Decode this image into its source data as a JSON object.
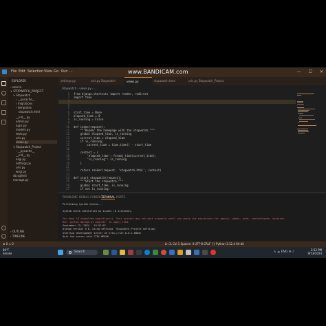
{
  "titlebar": {
    "menu": [
      "File",
      "Edit",
      "Selection",
      "View",
      "Go",
      "Run",
      "···"
    ],
    "watermark": "www.BANDICAM.com"
  },
  "sidebar": {
    "title": "EXPLORER",
    "items": [
      {
        "label": "› source"
      },
      {
        "label": "∨ STOPWATCH_PROJECT"
      },
      {
        "label": "∨ Stopwatch"
      },
      {
        "label": "› __pycache__"
      },
      {
        "label": "› migrations"
      },
      {
        "label": "› templates"
      },
      {
        "label": "stopwatch.html"
      },
      {
        "label": "__init__.py"
      },
      {
        "label": "admin.py"
      },
      {
        "label": "apps.py"
      },
      {
        "label": "models.py"
      },
      {
        "label": "tests.py"
      },
      {
        "label": "urls.py"
      },
      {
        "label": "views.py"
      },
      {
        "label": "∨ Stopwatch_Project"
      },
      {
        "label": "› __pycache__"
      },
      {
        "label": "__init__.py"
      },
      {
        "label": "asgi.py"
      },
      {
        "label": "settings.py"
      },
      {
        "label": "urls.py"
      },
      {
        "label": "wsgi.py"
      },
      {
        "label": "db.sqlite3"
      },
      {
        "label": "manage.py"
      },
      {
        "label": "› OUTLINE"
      },
      {
        "label": "› TIMELINE"
      }
    ]
  },
  "tabs": [
    {
      "label": "settings.py"
    },
    {
      "label": "urls.py  Stopwatch"
    },
    {
      "label": "views.py"
    },
    {
      "label": "stopwatch.html"
    },
    {
      "label": "urls.py  Stopwatch_Project"
    }
  ],
  "breadcrumb": "Stopwatch  ›  views.py  ›  ...",
  "editor": {
    "lines": [
      {
        "n": "1",
        "t": "from django.shortcuts import render, redirect"
      },
      {
        "n": "2",
        "t": "import time"
      },
      {
        "n": "3",
        "t": ""
      },
      {
        "n": "4",
        "t": ""
      },
      {
        "n": "5",
        "t": ""
      },
      {
        "n": "6",
        "t": "start_time = None"
      },
      {
        "n": "7",
        "t": "elapsed_time = 0"
      },
      {
        "n": "8",
        "t": "is_running = False"
      },
      {
        "n": "9",
        "t": ""
      },
      {
        "n": "10",
        "t": "def index(request):"
      },
      {
        "n": "11",
        "t": "    \"\"\"Render the homepage with the stopwatch.\"\"\""
      },
      {
        "n": "12",
        "t": "    global elapsed_time, is_running"
      },
      {
        "n": "13",
        "t": "    current_time = elapsed_time"
      },
      {
        "n": "14",
        "t": "    if is_running:"
      },
      {
        "n": "15",
        "t": "        current_time = time.time() - start_time"
      },
      {
        "n": "16",
        "t": ""
      },
      {
        "n": "17",
        "t": "    context = {"
      },
      {
        "n": "18",
        "t": "        'elapsed_time': format_time(current_time),"
      },
      {
        "n": "19",
        "t": "        'is_running': is_running"
      },
      {
        "n": "20",
        "t": "    }"
      },
      {
        "n": "21",
        "t": ""
      },
      {
        "n": "22",
        "t": "    return render(request, 'stopwatch.html', context)"
      },
      {
        "n": "23",
        "t": ""
      },
      {
        "n": "24",
        "t": "def start_stopwatch(request):"
      },
      {
        "n": "25",
        "t": "    \"\"\"Start the stopwatch.\"\"\""
      },
      {
        "n": "26",
        "t": "    global start_time, is_running"
      },
      {
        "n": "27",
        "t": "    if not is_running:"
      }
    ]
  },
  "panel": {
    "tabs": [
      "PROBLEMS",
      "DEBUG CONSOLE",
      "TERMINAL",
      "PORTS"
    ],
    "terminal": [
      "Performing system checks...",
      "",
      "System check identified no issues (0 silenced).",
      "",
      "You have 18 unapplied migration(s). Your project may not work properly until you apply the migrations for app(s): admin, auth, contenttypes, sessions.",
      "Run 'python manage.py migrate' to apply them.",
      "September 13, 2024 - 15:52:07",
      "Django version 5.0, using settings 'Stopwatch_Project.settings'",
      "Starting development server at http://127.0.0.1:8000/",
      "Quit the server with CTRL-BREAK."
    ]
  },
  "statusbar": {
    "left": "⊗ 0  ⚠ 0",
    "right": "Ln 3, Col 1   Spaces: 4   UTF-8   CRLF   {} Python   3.12.4 64-bit"
  },
  "taskbar": {
    "weather_temp": "80°F",
    "weather_desc": "Smoke",
    "search": "Search",
    "tray": "∧  ☁  ENG  ⊕  ♪",
    "time": "3:52 PM",
    "date": "9/13/2024"
  },
  "colors": {
    "accent": "#d9822b",
    "editor_bg": "#1e1e1e",
    "sidebar_bg": "#241c16",
    "titlebar_bg": "#3a2a1e",
    "taskbar_bg": "#20262e"
  }
}
